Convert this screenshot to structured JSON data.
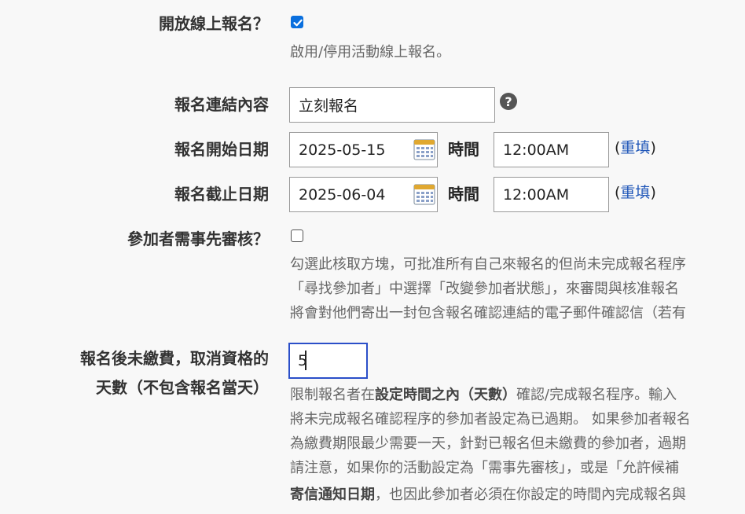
{
  "online_registration": {
    "label": "開放線上報名？",
    "checked": true,
    "help": "啟用/停用活動線上報名。"
  },
  "link_text": {
    "label": "報名連結內容",
    "value": "立刻報名",
    "help_icon": "question-circle-icon"
  },
  "start": {
    "label": "報名開始日期",
    "date": "2025-05-15",
    "time_label": "時間",
    "time": "12:00AM",
    "paren_open": "(",
    "reset_label": "重填",
    "paren_close": ")"
  },
  "end": {
    "label": "報名截止日期",
    "date": "2025-06-04",
    "time_label": "時間",
    "time": "12:00AM",
    "paren_open": "(",
    "reset_label": "重填",
    "paren_close": ")"
  },
  "approval": {
    "label": "參加者需事先審核？",
    "checked": false,
    "help_lines": [
      "勾選此核取方塊，可批准所有自己來報名的但尚未完成報名程序",
      "「尋找參加者」中選擇「改變參加者狀態」，來審閱與核准報名",
      "將會對他們寄出一封包含報名確認連結的電子郵件確認信（若有"
    ]
  },
  "expiry": {
    "label_line1": "報名後未繳費，取消資格的",
    "label_line2": "天數（不包含報名當天）",
    "value": "5",
    "help": {
      "l1_a": "限制報名者在",
      "l1_b": "設定時間之內（天數）",
      "l1_c": "確認/完成報名程序。輸入",
      "l2": "將未完成報名確認程序的參加者設定為已過期。 如果參加者報名",
      "l3": "為繳費期限最少需要一天，針對已報名但未繳費的參加者，過期",
      "l4": "請注意，如果你的活動設定為「需事先審核」，或是「允許候補",
      "l5_a": "寄信通知日期",
      "l5_b": "，也因此參加者必須在你設定的時間內完成報名與"
    }
  },
  "colors": {
    "accent": "#0a6fde",
    "link": "#1f56b8",
    "focus_border": "#2b4fc9"
  }
}
